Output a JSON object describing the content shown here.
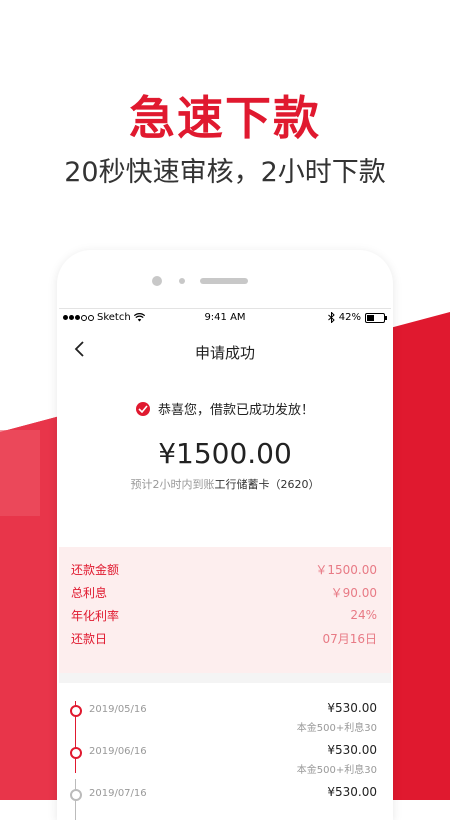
{
  "promo": {
    "headline": "急速下款",
    "subline": "20秒快速审核，2小时下款"
  },
  "colors": {
    "brand_red": "#e0192f",
    "light_pink": "#fdeeee"
  },
  "statusbar": {
    "carrier": "Sketch",
    "time": "9:41 AM",
    "battery": "42%",
    "battery_level": 0.42
  },
  "nav": {
    "title": "申请成功",
    "back_icon": "chevron-left-icon"
  },
  "result": {
    "message": "恭喜您，借款已成功发放！",
    "amount": "¥1500.00",
    "eta_prefix": "预计2小时内到账",
    "eta_bank": "工行储蓄卡（2620）"
  },
  "summary": [
    {
      "label": "还款金额",
      "value": "￥1500.00"
    },
    {
      "label": "总利息",
      "value": "￥90.00"
    },
    {
      "label": "年化利率",
      "value": "24%"
    },
    {
      "label": "还款日",
      "value": "07月16日"
    }
  ],
  "schedule": [
    {
      "date": "2019/05/16",
      "amount": "¥530.00",
      "detail": "本金500+利息30"
    },
    {
      "date": "2019/06/16",
      "amount": "¥530.00",
      "detail": "本金500+利息30"
    },
    {
      "date": "2019/07/16",
      "amount": "¥530.00",
      "detail": ""
    }
  ]
}
